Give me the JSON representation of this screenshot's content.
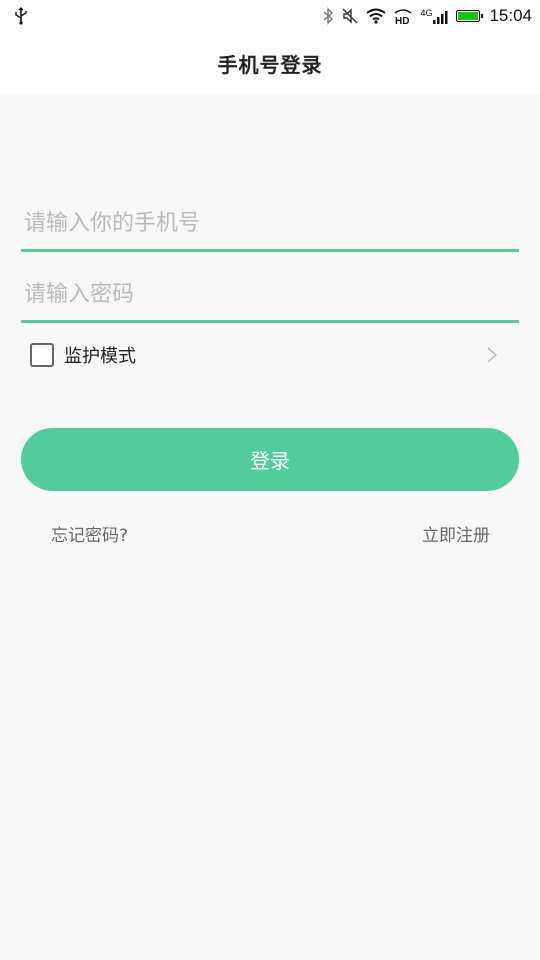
{
  "status_bar": {
    "time": "15:04",
    "network": "4G",
    "hd_label": "HD",
    "battery_level": 1.0,
    "icons": [
      "usb-icon",
      "bluetooth-icon",
      "mute-icon",
      "wifi-icon",
      "hd-icon",
      "signal-icon",
      "battery-icon"
    ]
  },
  "header": {
    "title": "手机号登录"
  },
  "form": {
    "phone_placeholder": "请输入你的手机号",
    "password_placeholder": "请输入密码",
    "monitor_label": "监护模式",
    "monitor_checked": false,
    "login_label": "登录"
  },
  "links": {
    "forgot": "忘记密码?",
    "register": "立即注册"
  },
  "colors": {
    "accent": "#52cc9a",
    "underline": "#5dc898",
    "background": "#f8f8f8",
    "battery": "#19c219"
  }
}
